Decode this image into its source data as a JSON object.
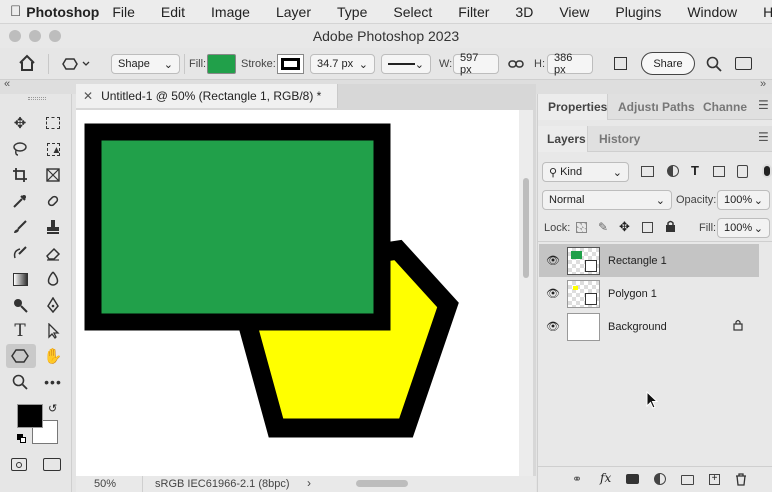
{
  "menubar": {
    "app_name": "Photoshop",
    "items": [
      "File",
      "Edit",
      "Image",
      "Layer",
      "Type",
      "Select",
      "Filter",
      "3D",
      "View",
      "Plugins",
      "Window",
      "Help"
    ]
  },
  "window": {
    "title": "Adobe Photoshop 2023"
  },
  "options": {
    "mode": "Shape",
    "fill_label": "Fill:",
    "stroke_label": "Stroke:",
    "stroke_width": "34.7 px",
    "w_label": "W:",
    "w_value": "597 px",
    "h_label": "H:",
    "h_value": "386 px",
    "share_label": "Share",
    "fill_color": "#21a04a",
    "stroke_color": "#000000"
  },
  "document": {
    "tab_title": "Untitled-1 @ 50% (Rectangle 1, RGB/8) *",
    "zoom": "50%",
    "color_profile": "sRGB IEC61966-2.1 (8bpc)"
  },
  "panels": {
    "top_tabs": [
      "Properties",
      "Adjustı",
      "Paths",
      "Channe"
    ],
    "layer_tabs": [
      "Layers",
      "History"
    ],
    "kind_label": "Kind",
    "blend_mode": "Normal",
    "opacity_label": "Opacity:",
    "opacity_value": "100%",
    "lock_label": "Lock:",
    "fill_label": "Fill:",
    "fill_value": "100%"
  },
  "layers": [
    {
      "name": "Rectangle 1",
      "selected": true
    },
    {
      "name": "Polygon 1",
      "selected": false
    },
    {
      "name": "Background",
      "selected": false,
      "locked": true
    }
  ],
  "colors": {
    "foreground": "#000000",
    "background": "#ffffff",
    "yellow": "#ffff00",
    "green": "#21a04a"
  }
}
